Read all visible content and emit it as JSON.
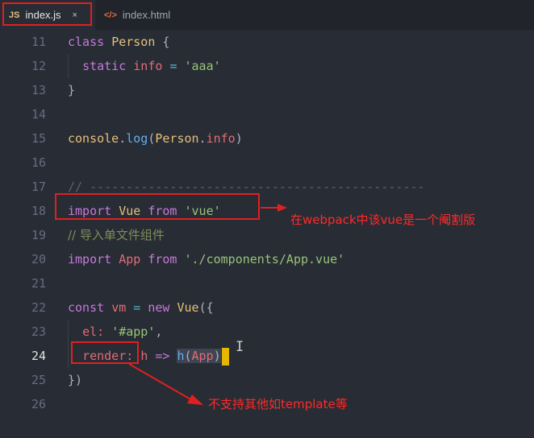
{
  "tabs": [
    {
      "icon": "JS",
      "label": "index.js",
      "close": "×",
      "active": true
    },
    {
      "icon": "</>",
      "label": "index.html",
      "active": false
    }
  ],
  "lines": [
    {
      "num": "11"
    },
    {
      "num": "12"
    },
    {
      "num": "13"
    },
    {
      "num": "14"
    },
    {
      "num": "15"
    },
    {
      "num": "16"
    },
    {
      "num": "17"
    },
    {
      "num": "18"
    },
    {
      "num": "19"
    },
    {
      "num": "20"
    },
    {
      "num": "21"
    },
    {
      "num": "22"
    },
    {
      "num": "23"
    },
    {
      "num": "24"
    },
    {
      "num": "25"
    },
    {
      "num": "26"
    }
  ],
  "code": {
    "l11": {
      "kw": "class",
      "name": "Person",
      "brace": "{"
    },
    "l12": {
      "kw": "static",
      "prop": "info",
      "op": "=",
      "str": "'aaa'"
    },
    "l13": {
      "brace": "}"
    },
    "l15": {
      "obj": "console",
      "dot": ".",
      "fn": "log",
      "open": "(",
      "cls": "Person",
      "dot2": ".",
      "prop": "info",
      "close": ")"
    },
    "l17": {
      "comment": "// ----------------------------------------------"
    },
    "l18": {
      "kw": "import",
      "name": "Vue",
      "kw2": "from",
      "str": "'vue'"
    },
    "l19": {
      "comment": "// 导入单文件组件"
    },
    "l20": {
      "kw": "import",
      "name": "App",
      "kw2": "from",
      "str": "'./components/App.vue'"
    },
    "l22": {
      "kw": "const",
      "name": "vm",
      "op": "=",
      "kw2": "new",
      "cls": "Vue",
      "open": "({"
    },
    "l23": {
      "key": "el:",
      "str": "'#app'",
      "comma": ","
    },
    "l24": {
      "key": "render:",
      "param": "h",
      "arrow": "=>",
      "fn": "h",
      "open": "(",
      "arg": "App",
      "close": ")"
    },
    "l25": {
      "close": "})"
    }
  },
  "annotations": {
    "vue_note": "在webpack中该vue是一个阉割版",
    "render_note": "不支持其他如template等"
  },
  "colors": {
    "background": "#282c34",
    "annotation": "#e02020",
    "cursor": "#e5b700"
  }
}
